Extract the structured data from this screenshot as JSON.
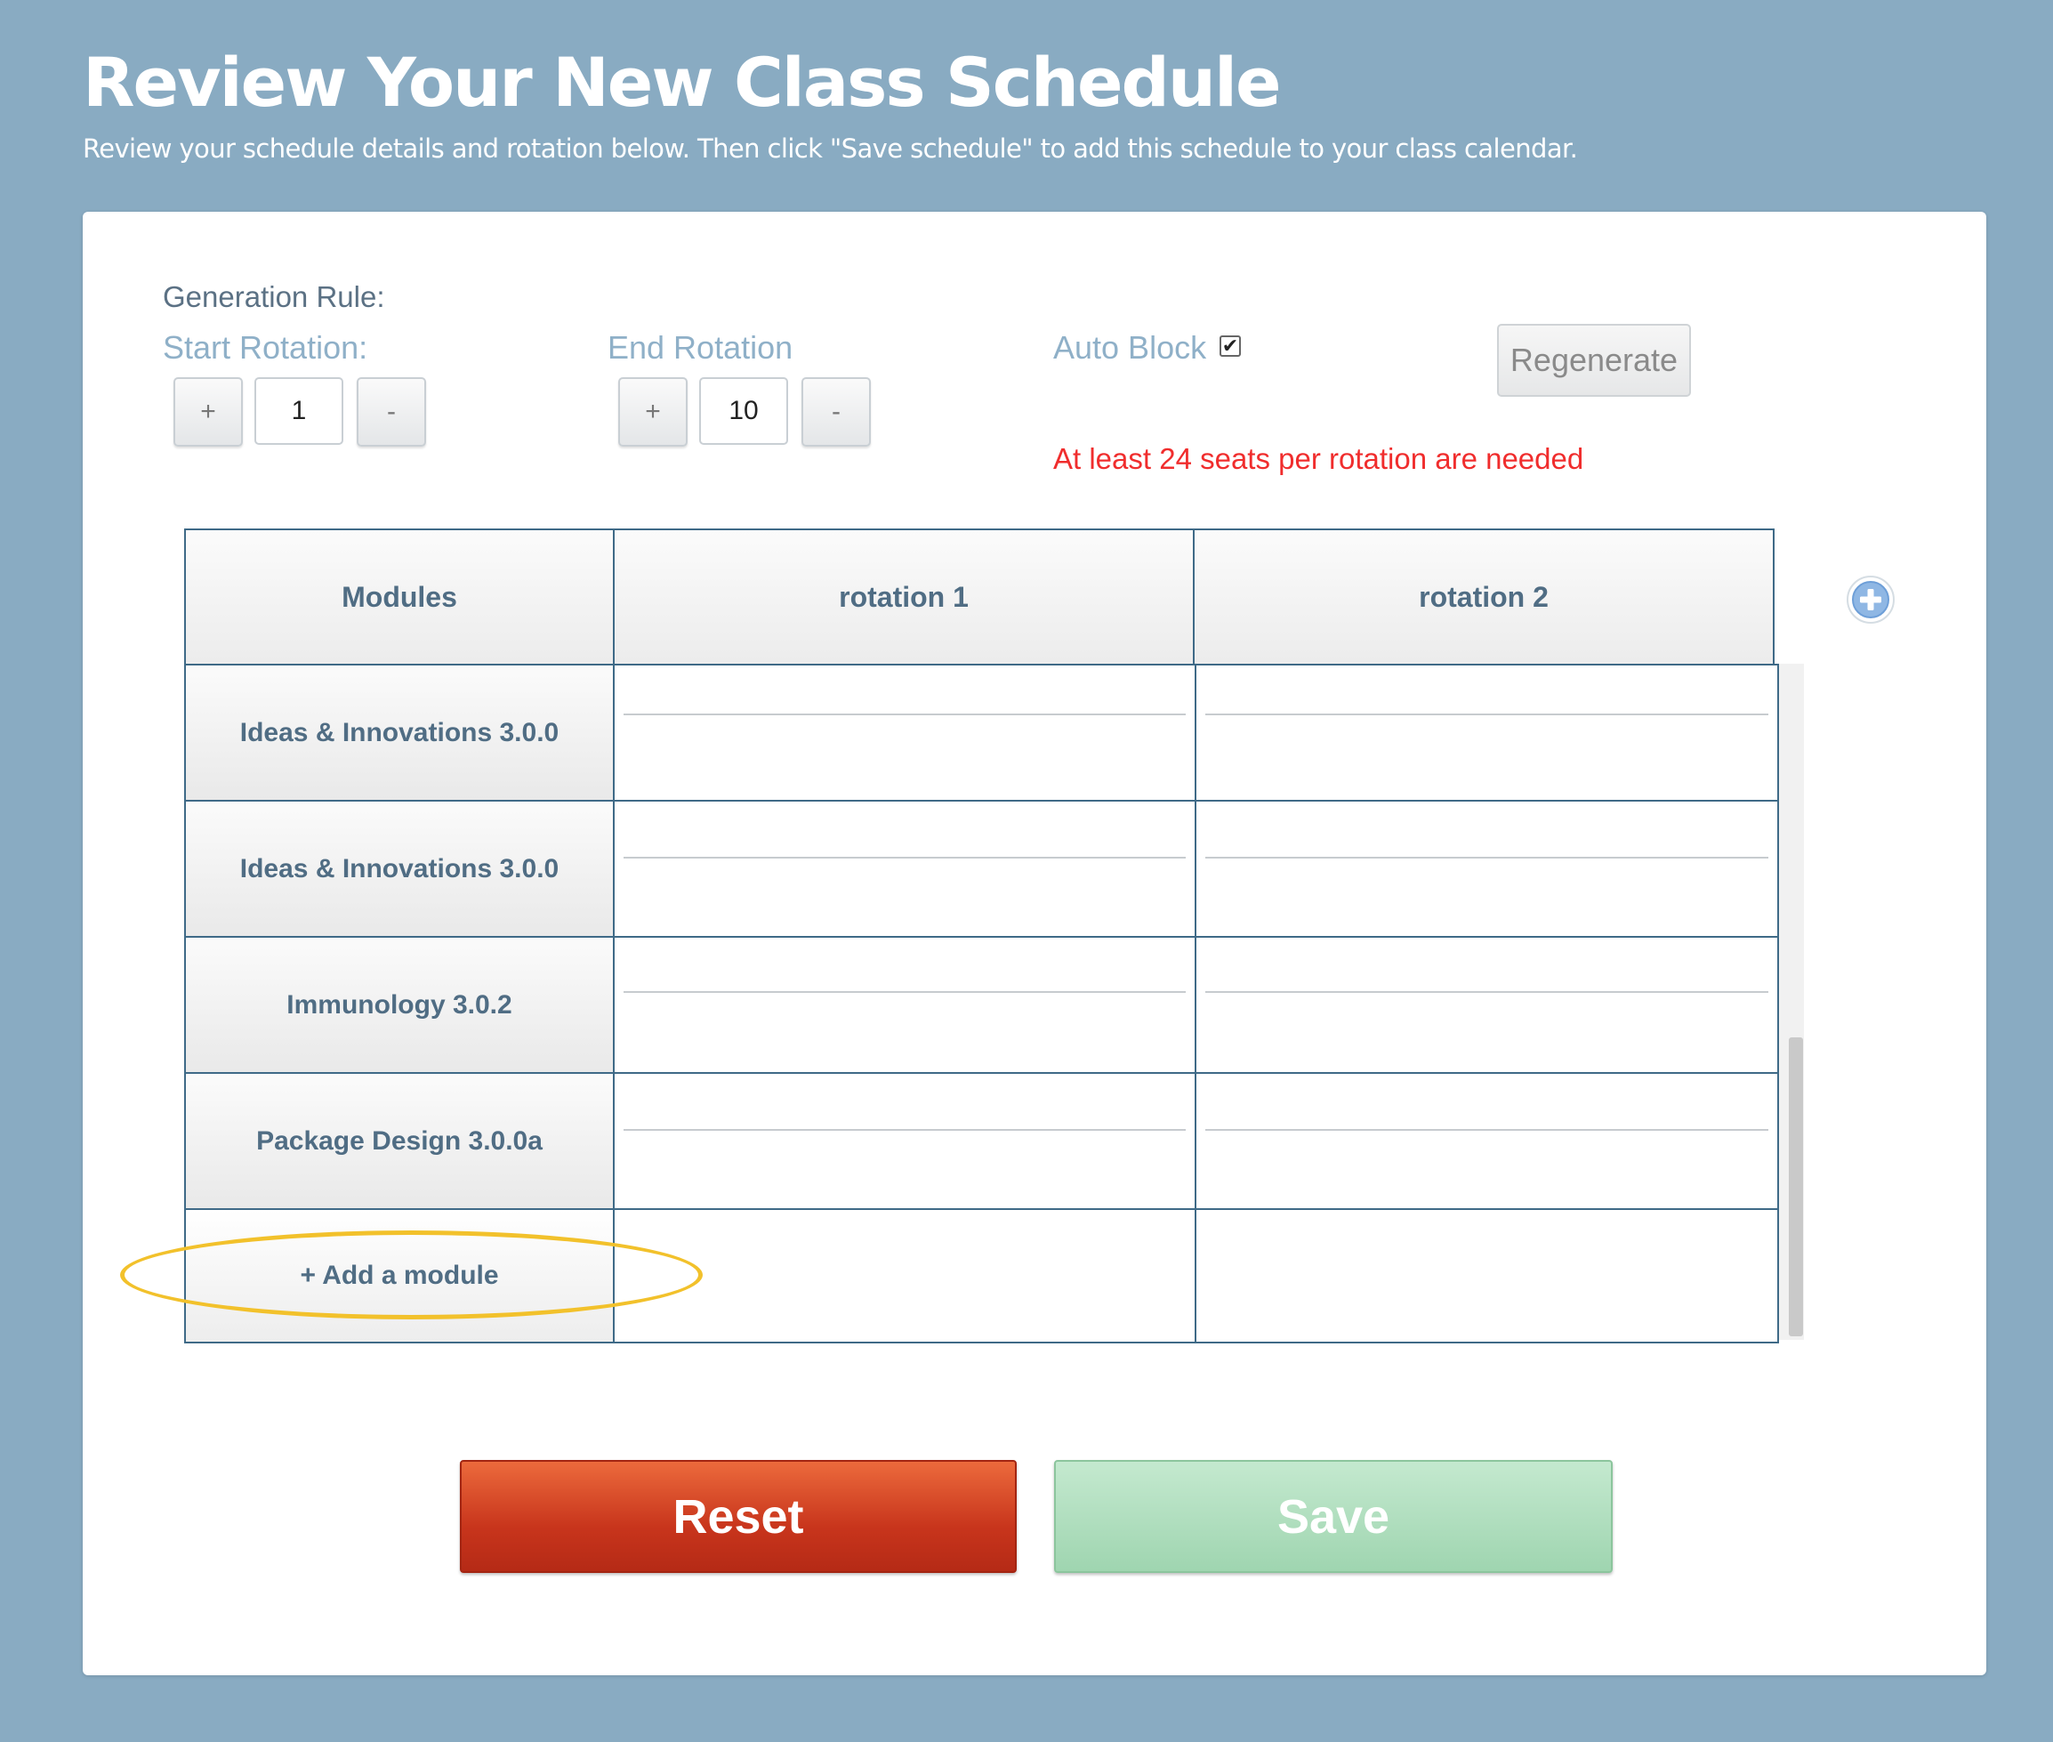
{
  "header": {
    "title": "Review Your New Class Schedule",
    "subtitle": "Review your schedule details and rotation below. Then click \"Save schedule\" to add this schedule to your class calendar."
  },
  "controls": {
    "generation_rule_label": "Generation Rule:",
    "start_rotation": {
      "label": "Start Rotation:",
      "plus": "+",
      "value": "1",
      "minus": "-"
    },
    "end_rotation": {
      "label": "End Rotation",
      "plus": "+",
      "value": "10",
      "minus": "-"
    },
    "auto_block": {
      "label": "Auto Block",
      "checked": true,
      "check_glyph": "✔"
    },
    "regenerate_label": "Regenerate",
    "warning": "At least 24 seats per rotation are needed",
    "warning_color": "#f02d2d"
  },
  "table": {
    "headers": [
      "Modules",
      "rotation 1",
      "rotation 2"
    ],
    "modules": [
      "Ideas & Innovations 3.0.0",
      "Ideas & Innovations 3.0.0",
      "Immunology 3.0.2",
      "Package Design 3.0.0a"
    ],
    "add_module_label": "+ Add a module",
    "add_column_icon": "plus-circle-icon"
  },
  "actions": {
    "reset_label": "Reset",
    "save_label": "Save",
    "reset_color": "#c8351c",
    "save_color": "#9fd5b0"
  },
  "accent_colors": {
    "background": "#89abc2",
    "highlight": "#f2c12b"
  }
}
